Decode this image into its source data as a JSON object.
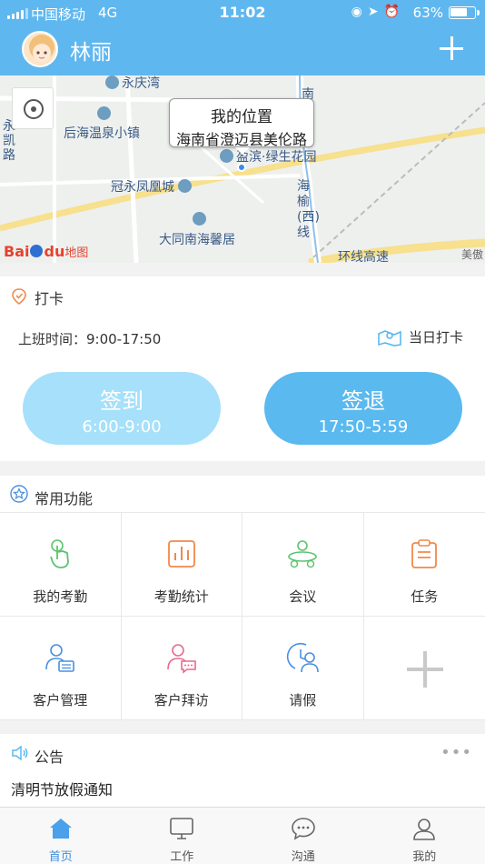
{
  "status_bar": {
    "carrier": "中国移动",
    "network": "4G",
    "time": "11:02",
    "battery": "63%"
  },
  "header": {
    "user_name": "林丽"
  },
  "map": {
    "callout_title": "我的位置",
    "callout_address": "海南省澄迈县美伦路",
    "labels": {
      "yongqingwan": "永庆湾",
      "houhai": "后海温泉小镇",
      "yongkai": "永凯路",
      "lvsheng": "盈滨·绿生花园",
      "guanyong": "冠永凤凰城",
      "datong": "大同南海馨居",
      "haiyu": "海榆(西)线",
      "huanxian": "环线高速",
      "meiao": "美傲",
      "nan": "南"
    },
    "logo_text": "Bai",
    "logo_text2": "du",
    "logo_map": "地图"
  },
  "checkin": {
    "title": "打卡",
    "work_time": "上班时间：9:00-17:50",
    "daily_label": "当日打卡",
    "sign_in": {
      "label": "签到",
      "time": "6:00-9:00"
    },
    "sign_out": {
      "label": "签退",
      "time": "17:50-5:59"
    }
  },
  "functions": {
    "title": "常用功能",
    "items": [
      {
        "label": "我的考勤",
        "icon": "hand-tap-icon",
        "color": "#5cc46e"
      },
      {
        "label": "考勤统计",
        "icon": "bar-chart-icon",
        "color": "#f0894a"
      },
      {
        "label": "会议",
        "icon": "meeting-icon",
        "color": "#5cc46e"
      },
      {
        "label": "任务",
        "icon": "clipboard-icon",
        "color": "#f0894a"
      },
      {
        "label": "客户管理",
        "icon": "customer-card-icon",
        "color": "#4a8fe0"
      },
      {
        "label": "客户拜访",
        "icon": "customer-chat-icon",
        "color": "#e86a8c"
      },
      {
        "label": "请假",
        "icon": "leave-clock-icon",
        "color": "#4a8fe0"
      }
    ]
  },
  "notice": {
    "title": "公告",
    "items": [
      "清明节放假通知"
    ]
  },
  "tabs": [
    {
      "label": "首页",
      "active": true
    },
    {
      "label": "工作",
      "active": false
    },
    {
      "label": "沟通",
      "active": false
    },
    {
      "label": "我的",
      "active": false
    }
  ]
}
